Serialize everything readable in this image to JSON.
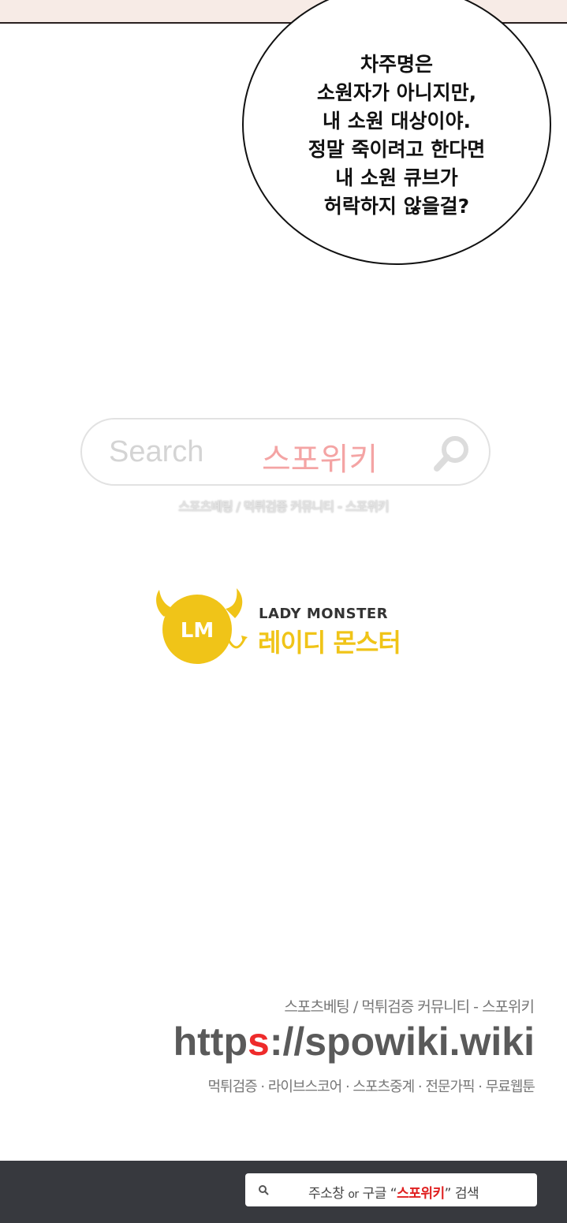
{
  "speech_bubble": {
    "lines": [
      "차주명은",
      "소원자가 아니지만,",
      "내 소원 대상이야.",
      "정말 죽이려고 한다면",
      "내 소원 큐브가",
      "허락하지 않을걸?"
    ]
  },
  "search_banner": {
    "search_word": "Search",
    "brand_text": "스포위키",
    "subtitle": "스포츠베팅 / 먹튀검증 커뮤니티 - 스포위키",
    "icon": "magnifier-icon"
  },
  "logo": {
    "badge": "LM",
    "name_en": "LADY MONSTER",
    "name_ko": "레이디 몬스터",
    "color": "#f0c418"
  },
  "promo": {
    "tagline": "스포츠베팅 / 먹튀검증 커뮤니티 - 스포위키",
    "url_prefix": "http",
    "url_highlight": "s",
    "url_suffix": "://spowiki.wiki",
    "categories": "먹튀검증 · 라이브스코어 · 스포츠중계 · 전문가픽 · 무료웹툰"
  },
  "footer": {
    "prefix": "주소창",
    "or": "or",
    "middle": "구글",
    "open_quote": "“",
    "brand": "스포위키",
    "close_quote": "”",
    "suffix": "검색",
    "brand_color": "#e02020",
    "icon": "search-icon"
  }
}
